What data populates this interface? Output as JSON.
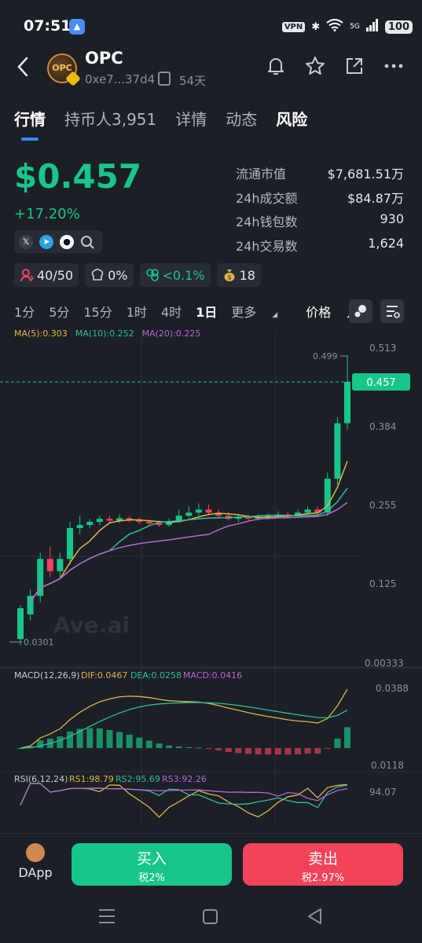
{
  "status": {
    "time": "07:51",
    "vpn": "VPN",
    "network": "5G",
    "battery": "100"
  },
  "token": {
    "name": "OPC",
    "avatar_text": "OPC",
    "address": "0xe7...37d4",
    "age": "54天"
  },
  "tabs": [
    {
      "label": "行情"
    },
    {
      "label": "持币人3,951"
    },
    {
      "label": "详情"
    },
    {
      "label": "动态"
    },
    {
      "label": "风险"
    }
  ],
  "price": {
    "value": "$0.457",
    "change": "+17.20%"
  },
  "stats": [
    {
      "label": "流通市值",
      "value": "$7,681.51万"
    },
    {
      "label": "24h成交额",
      "value": "$84.87万"
    },
    {
      "label": "24h钱包数",
      "value": "930"
    },
    {
      "label": "24h交易数",
      "value": "1,624"
    }
  ],
  "chips": [
    {
      "icon": "holder-icon",
      "text": "40/50"
    },
    {
      "icon": "chef-icon",
      "text": "0%"
    },
    {
      "icon": "bundle-icon",
      "text": "<0.1%",
      "color": "#17c68a"
    },
    {
      "icon": "money-bag-icon",
      "text": "18"
    }
  ],
  "intervals": [
    "1分",
    "5分",
    "15分",
    "1时",
    "4时",
    "1日",
    "更多",
    "价格"
  ],
  "selected_interval": "1日",
  "chart_data": [
    {
      "type": "candlestick",
      "title": "",
      "legend": [
        "MA(5):0.303",
        "MA(10):0.252",
        "MA(20):0.225"
      ],
      "y_ticks": [
        "0.513",
        "0.384",
        "0.255",
        "0.125",
        "0.00333"
      ],
      "ylim": [
        0.00333,
        0.513
      ],
      "current_price_label": "0.457",
      "high_label": "0.499",
      "low_label": "0.0301",
      "watermark": "Ave.ai",
      "candles": [
        {
          "o": 0.04,
          "c": 0.09,
          "h": 0.095,
          "l": 0.0301,
          "up": true
        },
        {
          "o": 0.08,
          "c": 0.11,
          "h": 0.12,
          "l": 0.07,
          "up": true
        },
        {
          "o": 0.11,
          "c": 0.17,
          "h": 0.18,
          "l": 0.1,
          "up": true
        },
        {
          "o": 0.17,
          "c": 0.15,
          "h": 0.19,
          "l": 0.14,
          "up": false
        },
        {
          "o": 0.15,
          "c": 0.17,
          "h": 0.18,
          "l": 0.14,
          "up": true
        },
        {
          "o": 0.17,
          "c": 0.22,
          "h": 0.23,
          "l": 0.16,
          "up": true
        },
        {
          "o": 0.22,
          "c": 0.225,
          "h": 0.24,
          "l": 0.21,
          "up": true
        },
        {
          "o": 0.225,
          "c": 0.23,
          "h": 0.235,
          "l": 0.22,
          "up": true
        },
        {
          "o": 0.23,
          "c": 0.235,
          "h": 0.24,
          "l": 0.225,
          "up": true
        },
        {
          "o": 0.235,
          "c": 0.232,
          "h": 0.24,
          "l": 0.228,
          "up": false
        },
        {
          "o": 0.232,
          "c": 0.236,
          "h": 0.242,
          "l": 0.228,
          "up": true
        },
        {
          "o": 0.236,
          "c": 0.233,
          "h": 0.24,
          "l": 0.229,
          "up": false
        },
        {
          "o": 0.233,
          "c": 0.23,
          "h": 0.237,
          "l": 0.226,
          "up": false
        },
        {
          "o": 0.23,
          "c": 0.228,
          "h": 0.234,
          "l": 0.224,
          "up": false
        },
        {
          "o": 0.228,
          "c": 0.225,
          "h": 0.232,
          "l": 0.222,
          "up": false
        },
        {
          "o": 0.225,
          "c": 0.23,
          "h": 0.235,
          "l": 0.222,
          "up": true
        },
        {
          "o": 0.23,
          "c": 0.24,
          "h": 0.25,
          "l": 0.228,
          "up": true
        },
        {
          "o": 0.24,
          "c": 0.245,
          "h": 0.255,
          "l": 0.236,
          "up": true
        },
        {
          "o": 0.245,
          "c": 0.25,
          "h": 0.26,
          "l": 0.24,
          "up": true
        },
        {
          "o": 0.25,
          "c": 0.245,
          "h": 0.258,
          "l": 0.24,
          "up": false
        },
        {
          "o": 0.245,
          "c": 0.24,
          "h": 0.25,
          "l": 0.235,
          "up": false
        },
        {
          "o": 0.24,
          "c": 0.235,
          "h": 0.246,
          "l": 0.232,
          "up": false
        },
        {
          "o": 0.235,
          "c": 0.238,
          "h": 0.242,
          "l": 0.23,
          "up": true
        },
        {
          "o": 0.238,
          "c": 0.236,
          "h": 0.242,
          "l": 0.232,
          "up": false
        },
        {
          "o": 0.236,
          "c": 0.238,
          "h": 0.242,
          "l": 0.232,
          "up": true
        },
        {
          "o": 0.238,
          "c": 0.24,
          "h": 0.244,
          "l": 0.234,
          "up": true
        },
        {
          "o": 0.24,
          "c": 0.242,
          "h": 0.247,
          "l": 0.236,
          "up": true
        },
        {
          "o": 0.242,
          "c": 0.24,
          "h": 0.246,
          "l": 0.237,
          "up": false
        },
        {
          "o": 0.24,
          "c": 0.245,
          "h": 0.25,
          "l": 0.237,
          "up": true
        },
        {
          "o": 0.245,
          "c": 0.25,
          "h": 0.255,
          "l": 0.24,
          "up": true
        },
        {
          "o": 0.25,
          "c": 0.245,
          "h": 0.255,
          "l": 0.24,
          "up": false
        },
        {
          "o": 0.245,
          "c": 0.3,
          "h": 0.31,
          "l": 0.24,
          "up": true
        },
        {
          "o": 0.3,
          "c": 0.39,
          "h": 0.4,
          "l": 0.29,
          "up": true
        },
        {
          "o": 0.39,
          "c": 0.457,
          "h": 0.499,
          "l": 0.38,
          "up": true
        }
      ]
    },
    {
      "type": "bar",
      "title": "MACD(12,26,9)",
      "legend": [
        "DIF:0.0467",
        "DEA:0.0258",
        "MACD:0.0416"
      ],
      "y_ticks": [
        "0.0388",
        "0.0118"
      ]
    },
    {
      "type": "line",
      "title": "RSI(6,12,24)",
      "legend": [
        "RS1:98.79",
        "RS2:95.69",
        "RS3:92.26"
      ],
      "y_ticks": [
        "94.07"
      ]
    }
  ],
  "colors": {
    "up": "#17c68a",
    "down": "#f2435a",
    "ma5": "#e2b443",
    "ma10": "#2bbf9e",
    "ma20": "#b667d6"
  },
  "bottom": {
    "dapp": "DApp",
    "buy": {
      "label": "买入",
      "tax": "税2%"
    },
    "sell": {
      "label": "卖出",
      "tax": "税2.97%"
    }
  }
}
